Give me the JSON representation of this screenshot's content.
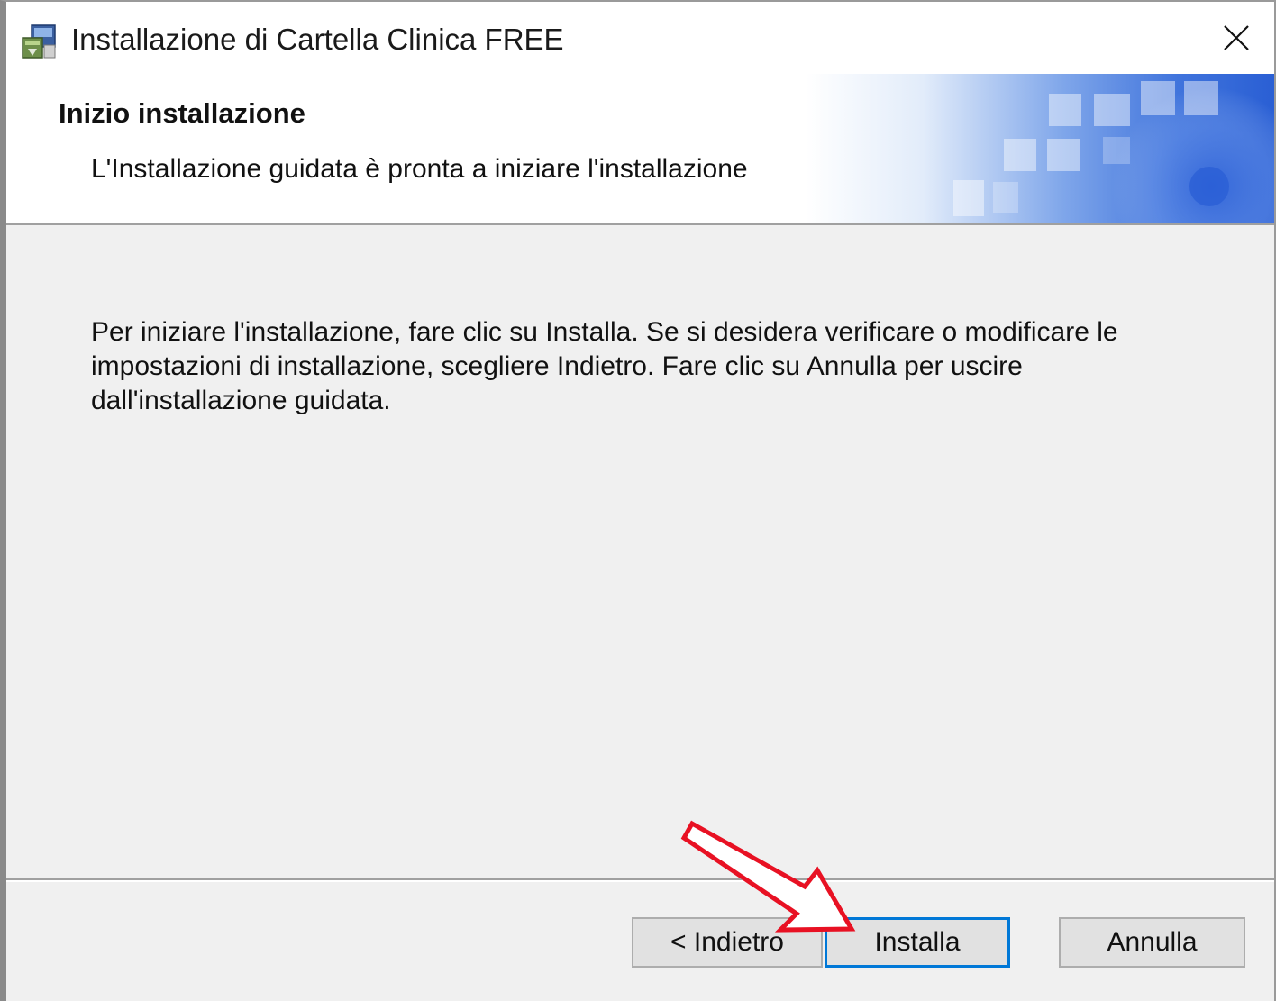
{
  "window": {
    "title": "Installazione di Cartella Clinica FREE",
    "app_icon": "installer-package-icon",
    "close_icon": "close-icon"
  },
  "banner": {
    "title": "Inizio installazione",
    "subtitle": "L'Installazione guidata è pronta a iniziare l'installazione"
  },
  "main": {
    "message": "Per iniziare l'installazione, fare clic su Installa. Se si desidera verificare o modificare le impostazioni di installazione, scegliere Indietro. Fare clic su Annulla per uscire dall'installazione guidata."
  },
  "buttons": {
    "back_label": "< Indietro",
    "install_label": "Installa",
    "cancel_label": "Annulla"
  },
  "annotation": {
    "arrow_color": "#e81123",
    "arrow_icon": "red-outline-arrow-icon"
  },
  "colors": {
    "focus_border": "#0078d7",
    "dialog_bg": "#f0f0f0",
    "button_bg": "#e1e1e1"
  }
}
